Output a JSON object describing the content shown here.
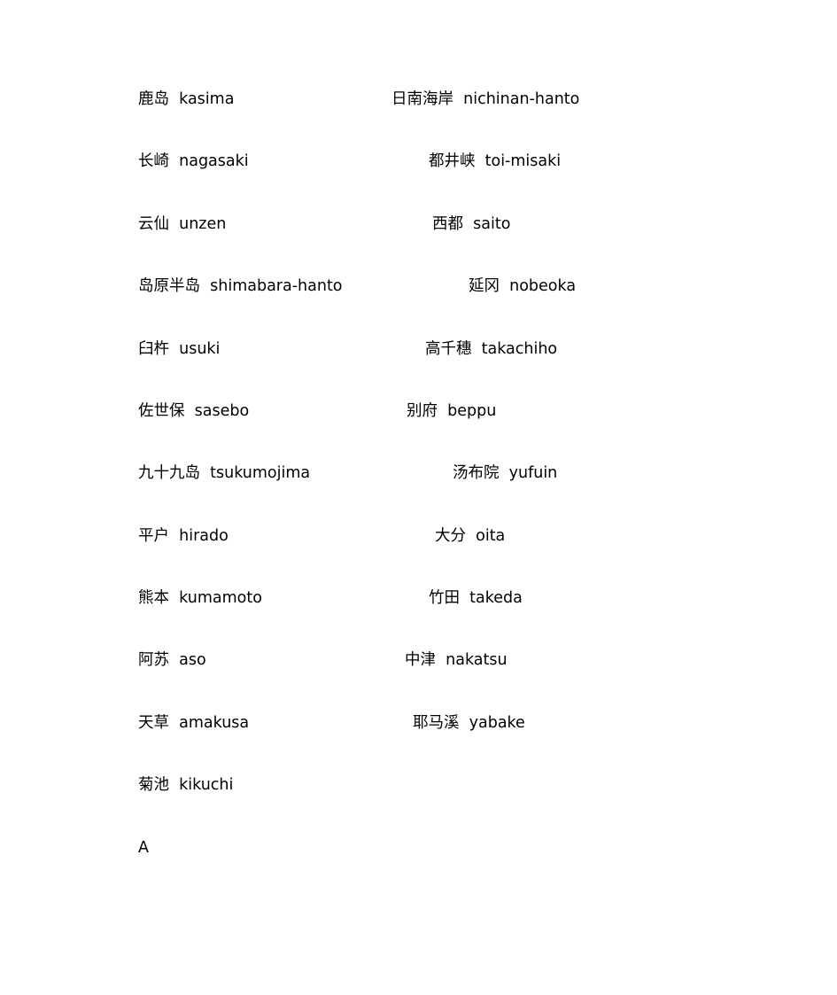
{
  "left_column": [
    "鹿岛  kasima",
    "长崎  nagasaki",
    "云仙  unzen",
    "岛原半岛  shimabara-hanto",
    "臼杵  usuki",
    "佐世保  sasebo",
    "九十九岛  tsukumojima",
    "平户  hirado",
    "熊本  kumamoto",
    "阿苏  aso",
    "天草  amakusa",
    "菊池  kikuchi",
    "A"
  ],
  "right_column": [
    "日南海岸  nichinan-hanto",
    "都井峡  toi-misaki",
    "西都  saito",
    "延冈  nobeoka",
    "高千穗  takachiho",
    "别府  beppu",
    "汤布院  yufuin",
    "大分  oita",
    "竹田  takeda",
    "中津  nakatsu",
    "耶马溪  yabake"
  ]
}
